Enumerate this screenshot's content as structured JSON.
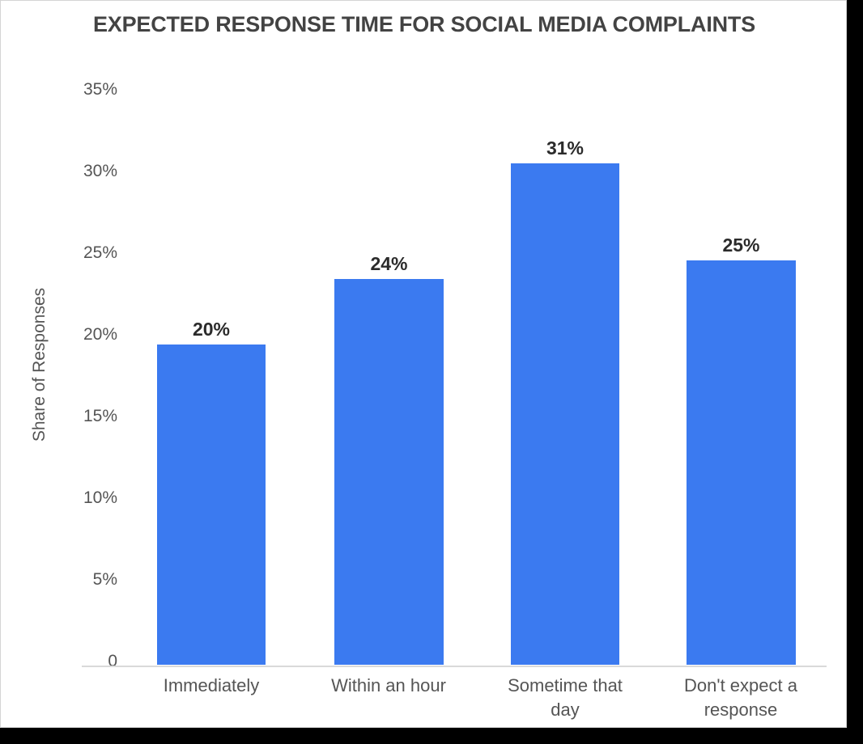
{
  "chart_data": {
    "type": "bar",
    "title": "EXPECTED RESPONSE TIME FOR SOCIAL MEDIA COMPLAINTS",
    "xlabel": "",
    "ylabel": "Share of Responses",
    "categories": [
      "Immediately",
      "Within an hour",
      "Sometime that day",
      "Don't expect a response"
    ],
    "values": [
      20,
      24,
      31,
      25
    ],
    "value_labels": [
      "20%",
      "24%",
      "31%",
      "25%"
    ],
    "ylim": [
      0,
      35
    ],
    "y_tick_values": [
      0,
      5,
      10,
      15,
      20,
      25,
      30,
      35
    ],
    "y_tick_labels": [
      "0",
      "5%",
      "10%",
      "15%",
      "20%",
      "25%",
      "30%",
      "35%"
    ],
    "grid": false,
    "legend": false,
    "legend_position": "none",
    "bar_color": "#3b7af0",
    "title_color": "#434343",
    "axis_label_color": "#555555",
    "value_label_color": "#2b2b2b",
    "axis_line_color": "#d9d9d9",
    "background_color": "#ffffff"
  },
  "x_labels_wrapped": [
    [
      "Immediately"
    ],
    [
      "Within an hour"
    ],
    [
      "Sometime that",
      "day"
    ],
    [
      "Don't expect a",
      "response"
    ]
  ]
}
